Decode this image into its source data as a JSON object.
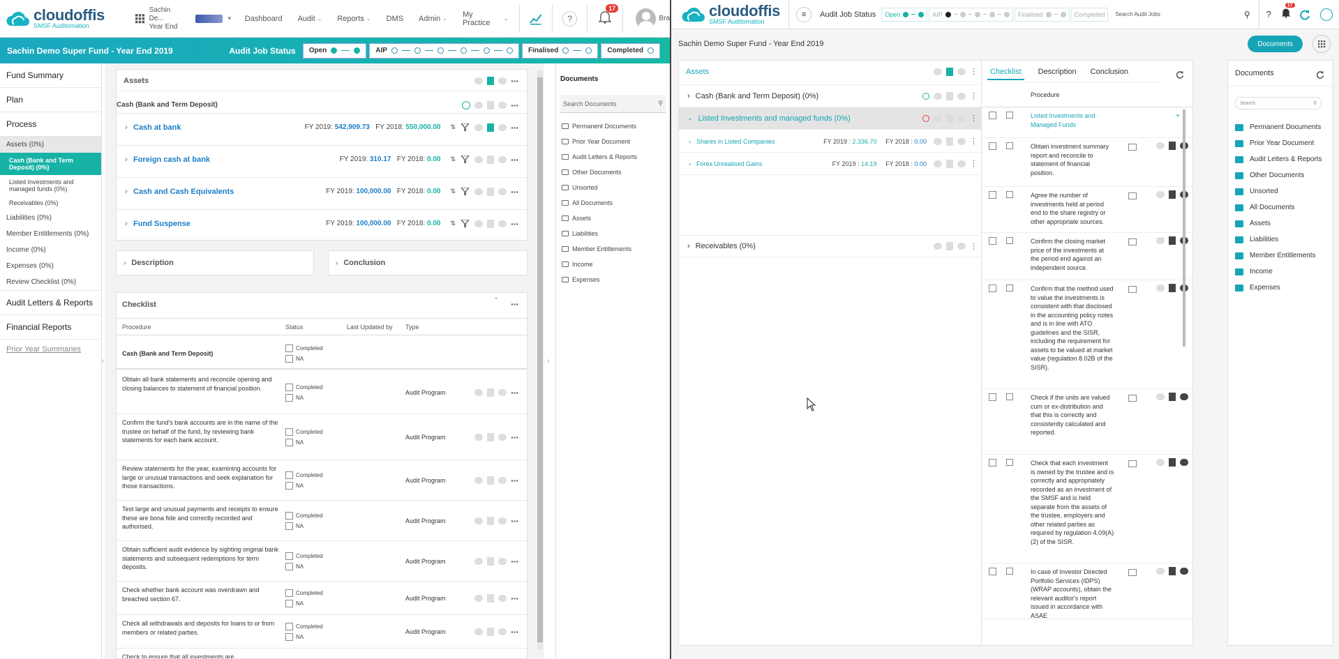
{
  "left": {
    "logo": {
      "name": "cloudoffis",
      "tagline": "SMSF Auditomation"
    },
    "fund_switch": {
      "name": "Sachin De...",
      "sub": "Year End"
    },
    "nav": [
      "Dashboard",
      "Audit",
      "Reports",
      "DMS",
      "Admin",
      "My Practice"
    ],
    "notif_count": "17",
    "user_initials": "Bra",
    "banner_title": "Sachin Demo Super Fund - Year End 2019",
    "status_label": "Audit Job Status",
    "status_pills": [
      "Open",
      "AIP",
      "Finalised",
      "Completed"
    ],
    "sidebar": {
      "items": [
        "Fund Summary",
        "Plan",
        "Process"
      ],
      "assets": "Assets (0%)",
      "asset_subs": [
        "Cash (Bank and Term Deposit) (0%)",
        "Listed Investments and managed funds (0%)",
        "Receivables (0%)"
      ],
      "sections": [
        "Liabilities (0%)",
        "Member Entitlements (0%)",
        "Income (0%)",
        "Expenses (0%)",
        "Review Checklist (0%)"
      ],
      "bottom": [
        "Audit Letters & Reports",
        "Financial Reports"
      ],
      "prior": "Prior Year Summaries"
    },
    "assets_title": "Assets",
    "cash_title": "Cash (Bank and Term Deposit)",
    "accounts": [
      {
        "name": "Cash at bank",
        "fy1": "FY 2019:",
        "v1": "542,909.73",
        "fy2": "FY 2018:",
        "v2": "550,000.00"
      },
      {
        "name": "Foreign cash at bank",
        "fy1": "FY 2019:",
        "v1": "310.17",
        "fy2": "FY 2018:",
        "v2": "0.00"
      },
      {
        "name": "Cash and Cash Equivalents",
        "fy1": "FY 2019:",
        "v1": "100,000.00",
        "fy2": "FY 2018:",
        "v2": "0.00"
      },
      {
        "name": "Fund Suspense",
        "fy1": "FY 2019:",
        "v1": "100,000.00",
        "fy2": "FY 2018:",
        "v2": "0.00"
      }
    ],
    "description": "Description",
    "conclusion": "Conclusion",
    "checklist": {
      "title": "Checklist",
      "headers": [
        "Procedure",
        "Status",
        "Last Updated by",
        "Type"
      ],
      "group": "Cash (Bank and Term Deposit)",
      "completed": "Completed",
      "na": "NA",
      "rows": [
        {
          "text": "Obtain all bank statements and reconcile opening and closing balances to statement of financial position.",
          "type": "Audit Program"
        },
        {
          "text": "Confirm the fund's bank accounts are in the name of the trustee on behalf of the fund, by reviewing bank statements for each bank account.",
          "type": "Audit Program"
        },
        {
          "text": "Review statements for the year, examining accounts for large or unusual transactions and seek explanation for those transactions.",
          "type": "Audit Program"
        },
        {
          "text": "Test large and unusual payments and receipts to ensure these are bona fide and correctly recorded and authorised.",
          "type": "Audit Program"
        },
        {
          "text": "Obtain sufficient audit evidence by sighting original bank statements and subsequent redemptions for term deposits.",
          "type": "Audit Program"
        },
        {
          "text": "Check whether bank account was overdrawn and breached section 67.",
          "type": "Audit Program"
        },
        {
          "text": "Check all withdrawals and deposits for loans to or from members or related parties.",
          "type": "Audit Program"
        },
        {
          "text": "Check to ensure that all investments are",
          "type": ""
        }
      ]
    },
    "docs": {
      "title": "Documents",
      "search": "Search Documents",
      "items": [
        "Permanent Documents",
        "Prior Year Document",
        "Audit Letters & Reports",
        "Other Documents",
        "Unsorted",
        "All Documents",
        "Assets",
        "Liabilities",
        "Member Entitlements",
        "Income",
        "Expenses"
      ]
    }
  },
  "right": {
    "status_label": "Audit Job Status",
    "pills": [
      "Open",
      "AIP",
      "Finalised",
      "Completed"
    ],
    "search_placeholder": "Search Audit Jobs",
    "notif_count": "17",
    "fund_title": "Sachin Demo Super Fund - Year End 2019",
    "documents_btn": "Documents",
    "assets_title": "Assets",
    "groups": [
      {
        "name": "Cash (Bank and Term Deposit) (0%)"
      },
      {
        "name": "Listed Investments and managed funds (0%)"
      },
      {
        "name": "Receivables (0%)"
      }
    ],
    "subrows": [
      {
        "name": "Shares in Listed Companies",
        "fy1": "FY 2019 :",
        "v1": "2,336.70",
        "fy2": "FY 2018 :",
        "v2": "0.00"
      },
      {
        "name": "Forex Unrealised Gains",
        "fy1": "FY 2019 :",
        "v1": "14.19",
        "fy2": "FY 2018 :",
        "v2": "0.00"
      }
    ],
    "tabs": [
      "Checklist",
      "Description",
      "Conclusion"
    ],
    "procedure_header": "Procedure",
    "cl_group": "Listed Investments and Managed Funds",
    "cl_items": [
      "Obtain investment summary report and reconcile to statement of financial position.",
      "Agree the number of investments held at period end to the share registry or other appropriate sources.",
      "Confirm the closing market price of the investments at the period end against an independent source.",
      "Confirm that the method used to value the investments is consistent with that disclosed in the accounting policy notes and is in line with ATO guidelines and the SISR, including the requirement for assets to be valued at market value (regulation 8.02B of the SISR).",
      "Check if the units are valued cum or ex-distribution and that this is correctly and consistently calculated and reported.",
      "Check that each investment is owned by the trustee and is correctly and appropriately recorded as an investment of the SMSF and is held separate from the assets of the trustee, employers and other related parties as required by regulation 4.09(A)(2) of the SISR.",
      "In case of Investor Directed Portfolio Services (IDPS) (WRAP accounts), obtain the relevant auditor's report issued in accordance with ASAE"
    ],
    "docs": {
      "title": "Documents",
      "search": "Search",
      "items": [
        "Permanent Documents",
        "Prior Year Document",
        "Audit Letters & Reports",
        "Other Documents",
        "Unsorted",
        "All Documents",
        "Assets",
        "Liabilities",
        "Member Entitlements",
        "Income",
        "Expenses"
      ]
    }
  }
}
